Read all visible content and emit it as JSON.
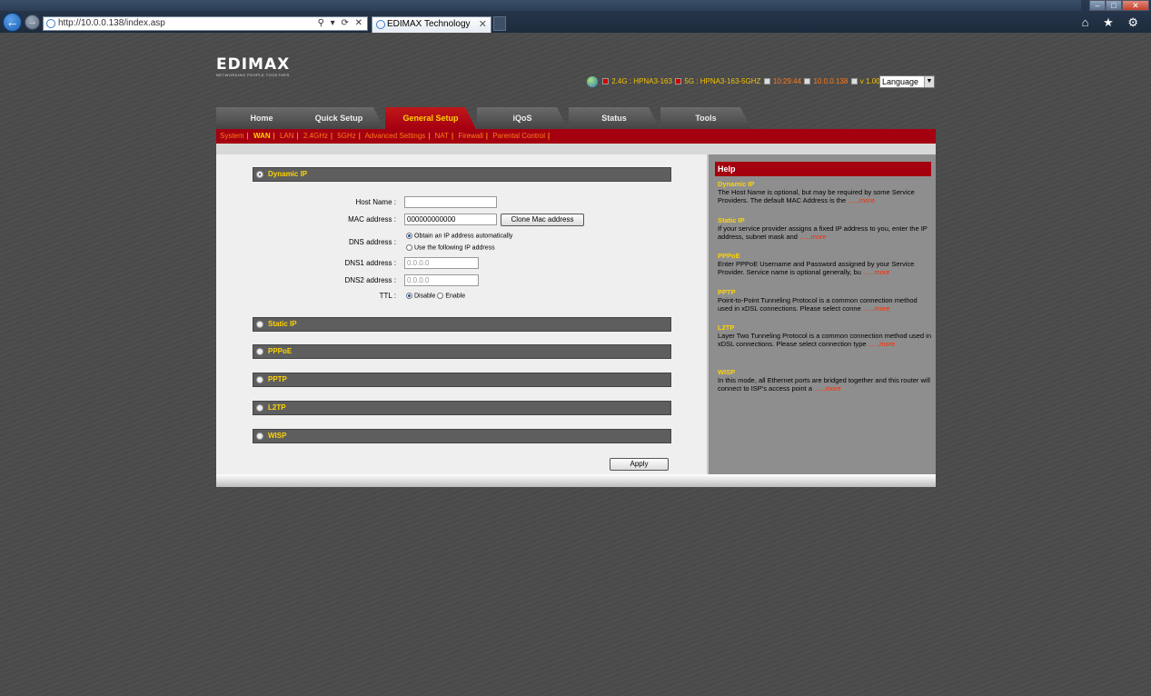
{
  "browser": {
    "url": "http://10.0.0.138/index.asp",
    "tab_title": "EDIMAX Technology",
    "close_glyph": "✕",
    "addr_tools": "⚲ ▾ ⟳ ✕",
    "right_icons": "⌂ ★ ⚙"
  },
  "header": {
    "brand": "EDIMAX",
    "tagline": "NETWORKING PEOPLE TOGETHER",
    "status": {
      "band24": "2.4G : HPNA3-163",
      "band5": "5G : HPNA3-163-5GHZ",
      "time": "10:29:44",
      "ip": "10.0.0.138",
      "version": "v 1.00"
    },
    "language": "Language"
  },
  "nav": {
    "tabs": [
      "Home",
      "Quick Setup",
      "General Setup",
      "iQoS",
      "Status",
      "Tools"
    ],
    "active": "General Setup"
  },
  "subnav": {
    "items": [
      "System",
      "WAN",
      "LAN",
      "2.4GHz",
      "5GHz",
      "Advanced Settings",
      "NAT",
      "Firewall",
      "Parental Control"
    ],
    "active": "WAN",
    "sep": "|"
  },
  "form": {
    "sections": {
      "dynamic_ip": "Dynamic IP",
      "static_ip": "Static IP",
      "pppoe": "PPPoE",
      "pptp": "PPTP",
      "l2tp": "L2TP",
      "wisp": "WISP"
    },
    "host_name_label": "Host Name :",
    "host_name_value": "",
    "mac_label": "MAC address :",
    "mac_value": "000000000000",
    "clone_mac_button": "Clone Mac address",
    "dns_label": "DNS address :",
    "dns_auto": "Obtain an IP address automatically",
    "dns_manual": "Use the following IP address",
    "dns1_label": "DNS1 address :",
    "dns1_value": "0.0.0.0",
    "dns2_label": "DNS2 address :",
    "dns2_value": "0.0.0.0",
    "ttl_label": "TTL :",
    "ttl_disable": "Disable",
    "ttl_enable": "Enable",
    "apply_button": "Apply"
  },
  "help": {
    "title": "Help",
    "items": [
      {
        "title": "Dynamic IP",
        "text": "The Host Name is optional, but may be required by some Service Providers. The default MAC Address is the",
        "more": "......more"
      },
      {
        "title": "Static IP",
        "text": "If your service provider assigns a fixed IP address to you, enter the IP address, subnet mask and",
        "more": "......more"
      },
      {
        "title": "PPPoE",
        "text": "Enter PPPoE Username and Password assigned by your Service Provider. Service name is optional generally, bu",
        "more": "......more"
      },
      {
        "title": "PPTP",
        "text": "Point-to-Point Tunneling Protocol is a common connection method used in xDSL connections. Please select conne",
        "more": "......more"
      },
      {
        "title": "L2TP",
        "text": "Layer Two Tunneling Protocol is a common connection method used in xDSL connections. Please select connection type",
        "more": "......more"
      },
      {
        "title": "WISP",
        "text": "In this mode, all Ethernet ports are bridged together and this router will connect to ISP's access point a",
        "more": "......more"
      }
    ]
  }
}
